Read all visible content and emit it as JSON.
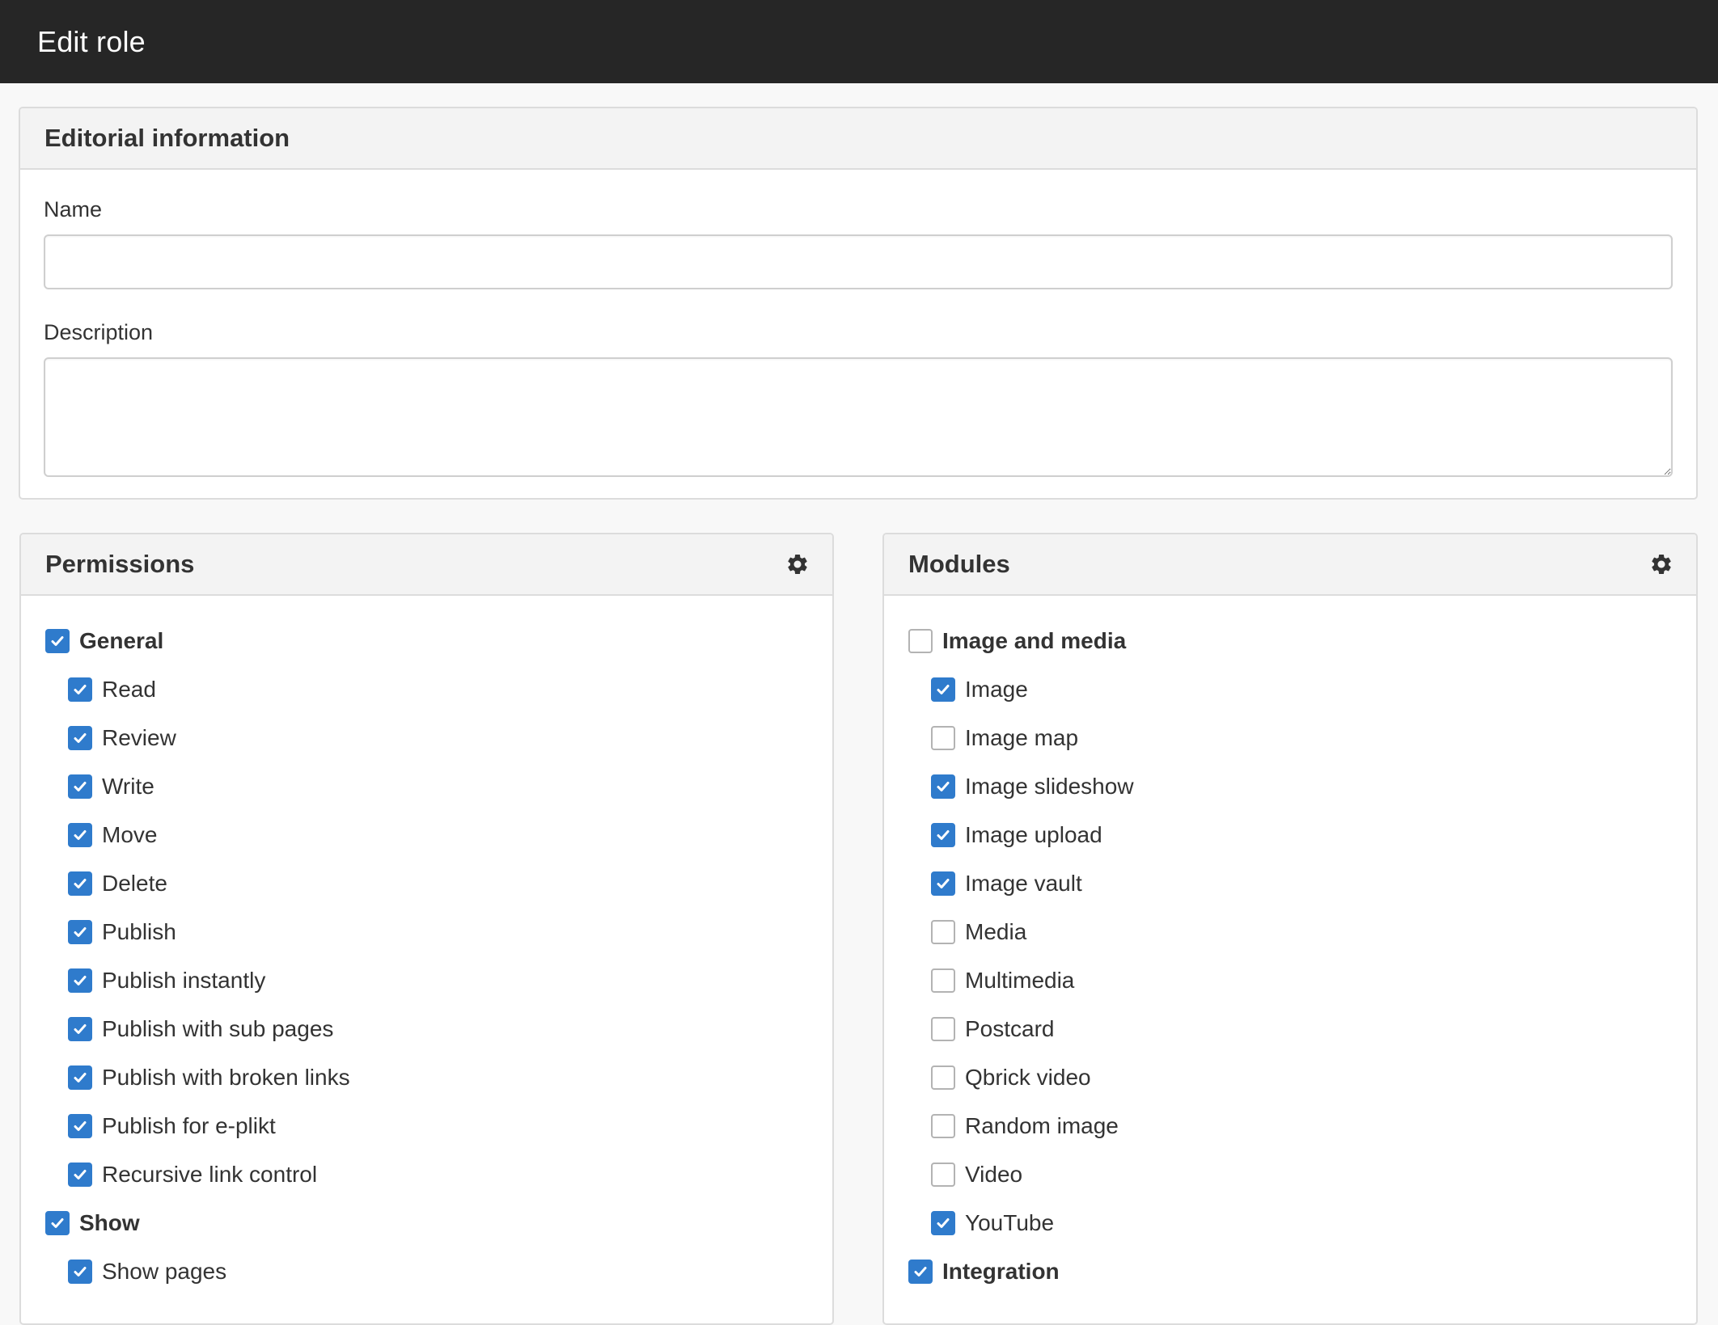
{
  "header": {
    "title": "Edit role"
  },
  "editorial": {
    "title": "Editorial information",
    "name_label": "Name",
    "name_value": "",
    "description_label": "Description",
    "description_value": ""
  },
  "permissions": {
    "title": "Permissions",
    "settings_icon": "gear-icon",
    "items": [
      {
        "label": "General",
        "checked": true,
        "group": true
      },
      {
        "label": "Read",
        "checked": true,
        "group": false
      },
      {
        "label": "Review",
        "checked": true,
        "group": false
      },
      {
        "label": "Write",
        "checked": true,
        "group": false
      },
      {
        "label": "Move",
        "checked": true,
        "group": false
      },
      {
        "label": "Delete",
        "checked": true,
        "group": false
      },
      {
        "label": "Publish",
        "checked": true,
        "group": false
      },
      {
        "label": "Publish instantly",
        "checked": true,
        "group": false
      },
      {
        "label": "Publish with sub pages",
        "checked": true,
        "group": false
      },
      {
        "label": "Publish with broken links",
        "checked": true,
        "group": false
      },
      {
        "label": "Publish for e-plikt",
        "checked": true,
        "group": false
      },
      {
        "label": "Recursive link control",
        "checked": true,
        "group": false
      },
      {
        "label": "Show",
        "checked": true,
        "group": true
      },
      {
        "label": "Show pages",
        "checked": true,
        "group": false
      }
    ]
  },
  "modules": {
    "title": "Modules",
    "settings_icon": "gear-icon",
    "items": [
      {
        "label": "Image and media",
        "checked": false,
        "group": true
      },
      {
        "label": "Image",
        "checked": true,
        "group": false
      },
      {
        "label": "Image map",
        "checked": false,
        "group": false
      },
      {
        "label": "Image slideshow",
        "checked": true,
        "group": false
      },
      {
        "label": "Image upload",
        "checked": true,
        "group": false
      },
      {
        "label": "Image vault",
        "checked": true,
        "group": false
      },
      {
        "label": "Media",
        "checked": false,
        "group": false
      },
      {
        "label": "Multimedia",
        "checked": false,
        "group": false
      },
      {
        "label": "Postcard",
        "checked": false,
        "group": false
      },
      {
        "label": "Qbrick video",
        "checked": false,
        "group": false
      },
      {
        "label": "Random image",
        "checked": false,
        "group": false
      },
      {
        "label": "Video",
        "checked": false,
        "group": false
      },
      {
        "label": "YouTube",
        "checked": true,
        "group": false
      },
      {
        "label": "Integration",
        "checked": true,
        "group": true
      }
    ]
  },
  "colors": {
    "topbar": "#262626",
    "checkbox_checked": "#2f7bcc",
    "panel_header": "#f3f3f3"
  }
}
